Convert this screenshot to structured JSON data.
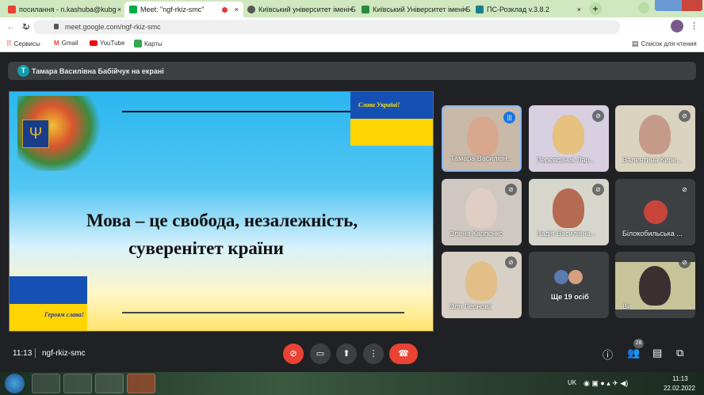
{
  "browser": {
    "tabs": [
      {
        "label": "посилання - n.kashuba@kubg",
        "color": "#ea4335"
      },
      {
        "label": "Meet: \"ngf-rkiz-smc\"",
        "color": "#00ac47",
        "active": true
      },
      {
        "label": "Київський університет імені Б",
        "color": "#555"
      },
      {
        "label": "Київський Університет імені Б",
        "color": "#2b8a3e"
      },
      {
        "label": "ПС-Розклад v.3.8.2",
        "color": "#1a7f8e"
      }
    ],
    "close_glyph": "×",
    "new_tab": "+",
    "url": "meet.google.com/ngf-rkiz-smc",
    "bookmarks": [
      "Сервисы",
      "Gmail",
      "YouTube",
      "Карты"
    ],
    "reading_list": "Список для чтения"
  },
  "meet": {
    "presenting_banner": "Тамара Василівна Бабійчук на екрані",
    "banner_avatar": "Т",
    "slide": {
      "line1": "Мова – це свобода, незалежність,",
      "line2": "суверенітет країни",
      "slava": "Слава Україні!",
      "heroyam": "Героям слава!"
    },
    "tiles": [
      {
        "name": "Тамара Василівн...",
        "speaking": true
      },
      {
        "name": "Перевозник Лар..."
      },
      {
        "name": "Валентина Кири..."
      },
      {
        "name": "Олена Карпенко"
      },
      {
        "name": "Надія Василівна..."
      },
      {
        "name": "Білокобильська ..."
      },
      {
        "name": "Оля Леонова"
      },
      {
        "name": "Ще 19 осіб"
      },
      {
        "name": "Ви"
      }
    ],
    "time": "11:13",
    "meeting_code": "ngf-rkiz-smc",
    "participants_count": "28"
  },
  "taskbar": {
    "lang": "UK",
    "time": "11:13",
    "date": "22.02.2022"
  }
}
